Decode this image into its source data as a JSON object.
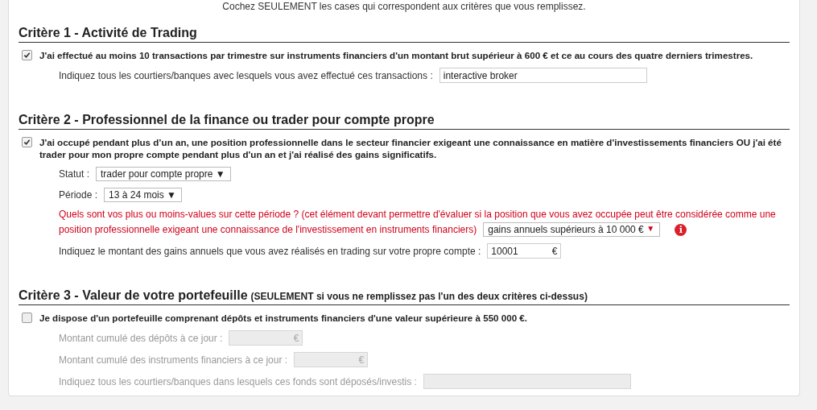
{
  "intro": "Cochez SEULEMENT les cases qui correspondent aux critères que vous remplissez.",
  "sections": [
    {
      "title": "Critère 1 - Activité de Trading",
      "items": [
        {
          "kind": "checkbox",
          "label": "J'ai effectué au moins 10 transactions par trimestre sur instruments financiers d'un montant brut supérieur à 600 € et ce au cours des quatre derniers trimestres.",
          "checked": true
        },
        {
          "kind": "text",
          "label": "Indiquez tous les courtiers/banques avec lesquels vous avez effectué ces transactions :",
          "value": "interactive broker",
          "disabled": false
        }
      ]
    },
    {
      "title": "Critère 2 - Professionnel de la finance ou trader pour compte propre",
      "items": [
        {
          "kind": "checkbox",
          "label": "J'ai occupé pendant plus d’un an, une position professionnelle dans le secteur financier exigeant une connaissance en matière d'investissements financiers OU j'ai été trader pour mon propre compte pendant plus d'un an et j'ai réalisé des gains significatifs.",
          "checked": true
        },
        {
          "kind": "select",
          "label": "Statut :",
          "value": "trader pour compte propre",
          "caret": "▼"
        },
        {
          "kind": "select",
          "label": "Période :",
          "value": "13 à 24 mois",
          "caret": "▼"
        },
        {
          "kind": "warning-select",
          "label": [
            "Quels sont vos plus ou moins-values sur cette période ? (cet élément devant permettre d'évaluer si la position que vous avez occupée peut être considérée comme une",
            "position professionnelle exigeant une connaissance de l'investissement en instruments financiers)"
          ],
          "value": "gains annuels supérieurs à 10 000 €",
          "caret": "▼",
          "icon": "i"
        },
        {
          "kind": "amount",
          "label": "Indiquez le montant des gains annuels que vous avez réalisés en trading sur votre propre compte :",
          "value": "10001",
          "suffix": "€",
          "disabled": false
        }
      ]
    },
    {
      "title": "Critère 3 - Valeur de votre portefeuille",
      "note": "(SEULEMENT si vous ne remplissez pas l'un des deux critères ci-dessus)",
      "items": [
        {
          "kind": "checkbox",
          "label": "Je dispose d'un portefeuille comprenant dépôts et instruments financiers d'une valeur supérieure à 550 000 €.",
          "checked": false
        },
        {
          "kind": "amount",
          "label": "Montant cumulé des dépôts à ce jour :",
          "suffix": "€",
          "disabled": true
        },
        {
          "kind": "amount",
          "label": "Montant cumulé des instruments financiers à ce jour :",
          "suffix": "€",
          "disabled": true
        },
        {
          "kind": "text",
          "label": "Indiquez tous les courtiers/banques dans lesquels ces fonds sont déposés/investis :",
          "disabled": true
        }
      ]
    }
  ]
}
